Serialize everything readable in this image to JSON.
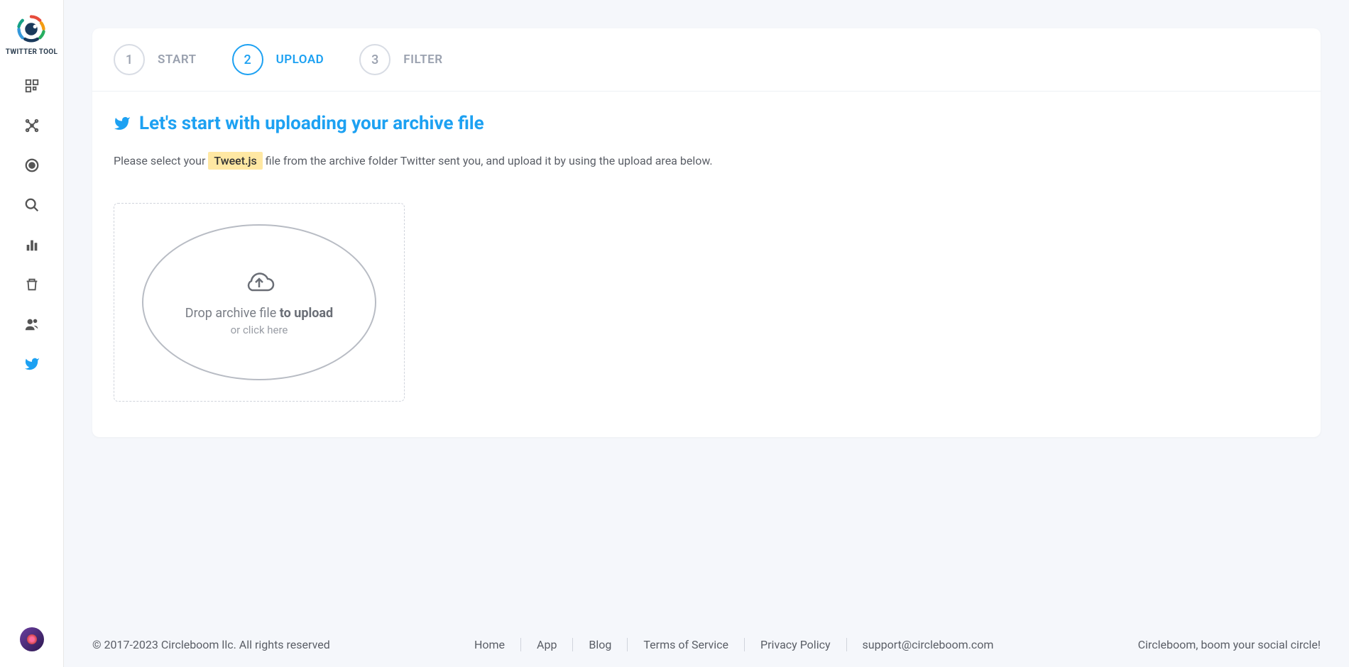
{
  "brand": {
    "name": "TWITTER TOOL"
  },
  "steps": [
    {
      "num": "1",
      "label": "START",
      "active": false
    },
    {
      "num": "2",
      "label": "UPLOAD",
      "active": true
    },
    {
      "num": "3",
      "label": "FILTER",
      "active": false
    }
  ],
  "heading": "Let's start with uploading your archive file",
  "instruction": {
    "pre": "Please select your ",
    "highlight": "Tweet.js",
    "post": " file from the archive folder Twitter sent you, and upload it by using the upload area below."
  },
  "dropzone": {
    "line1_pre": "Drop archive file ",
    "line1_strong": "to upload",
    "line2": "or click here"
  },
  "footer": {
    "copyright": "© 2017-2023 Circleboom llc. All rights reserved",
    "links": [
      "Home",
      "App",
      "Blog",
      "Terms of Service",
      "Privacy Policy",
      "support@circleboom.com"
    ],
    "tagline": "Circleboom, boom your social circle!"
  }
}
